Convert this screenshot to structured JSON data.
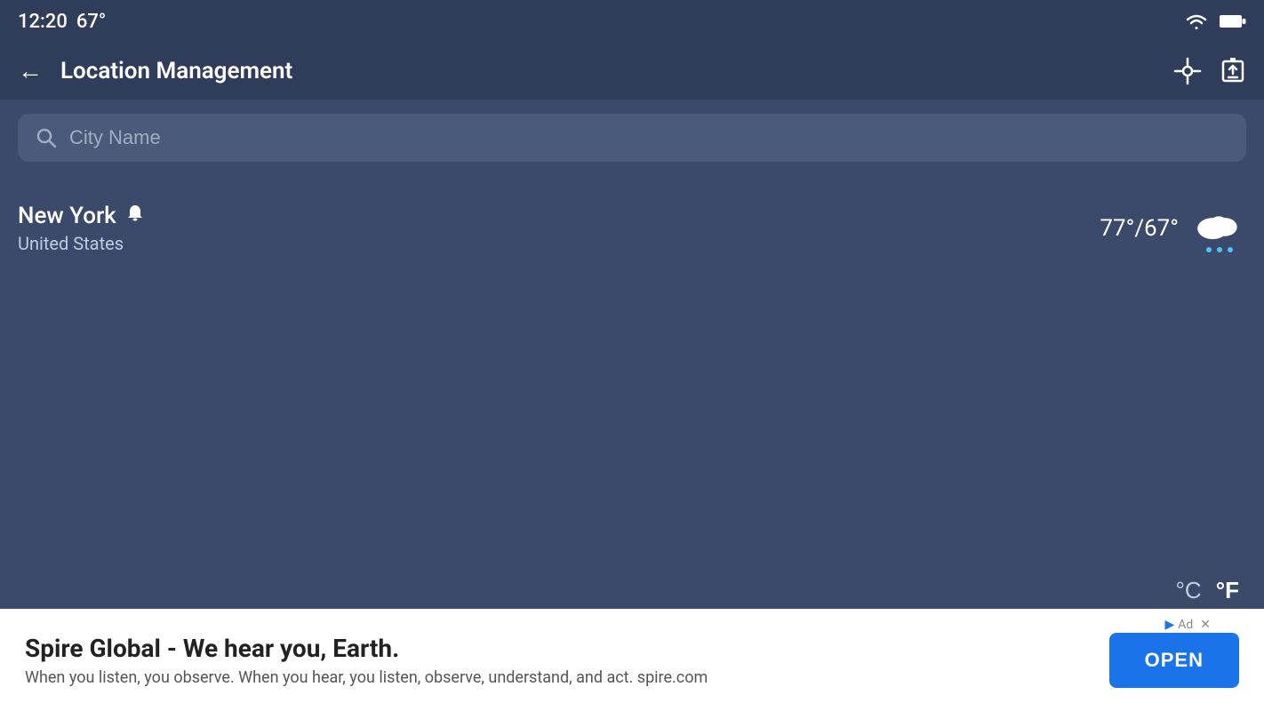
{
  "status_bar": {
    "time": "12:20",
    "temperature": "67°"
  },
  "header": {
    "title": "Location Management",
    "back_label": "←"
  },
  "search": {
    "placeholder": "City Name"
  },
  "locations": [
    {
      "city": "New York",
      "country": "United States",
      "has_notification": true,
      "temp_high": "77°",
      "temp_low": "67°",
      "temp_display": "77°/67°",
      "weather_condition": "cloudy-rain"
    }
  ],
  "temp_units": {
    "celsius_label": "°C",
    "fahrenheit_label": "°F"
  },
  "ad": {
    "title": "Spire Global - We hear you, Earth.",
    "subtitle": "When you listen, you observe. When you hear, you listen, observe, understand, and act. spire.com",
    "open_label": "OPEN",
    "ad_indicator": "Ad"
  },
  "icons": {
    "back": "←",
    "gps": "⊕",
    "edit": "✎",
    "search": "🔍",
    "bell": "🔔",
    "close": "✕",
    "ad_arrow": "▶"
  }
}
